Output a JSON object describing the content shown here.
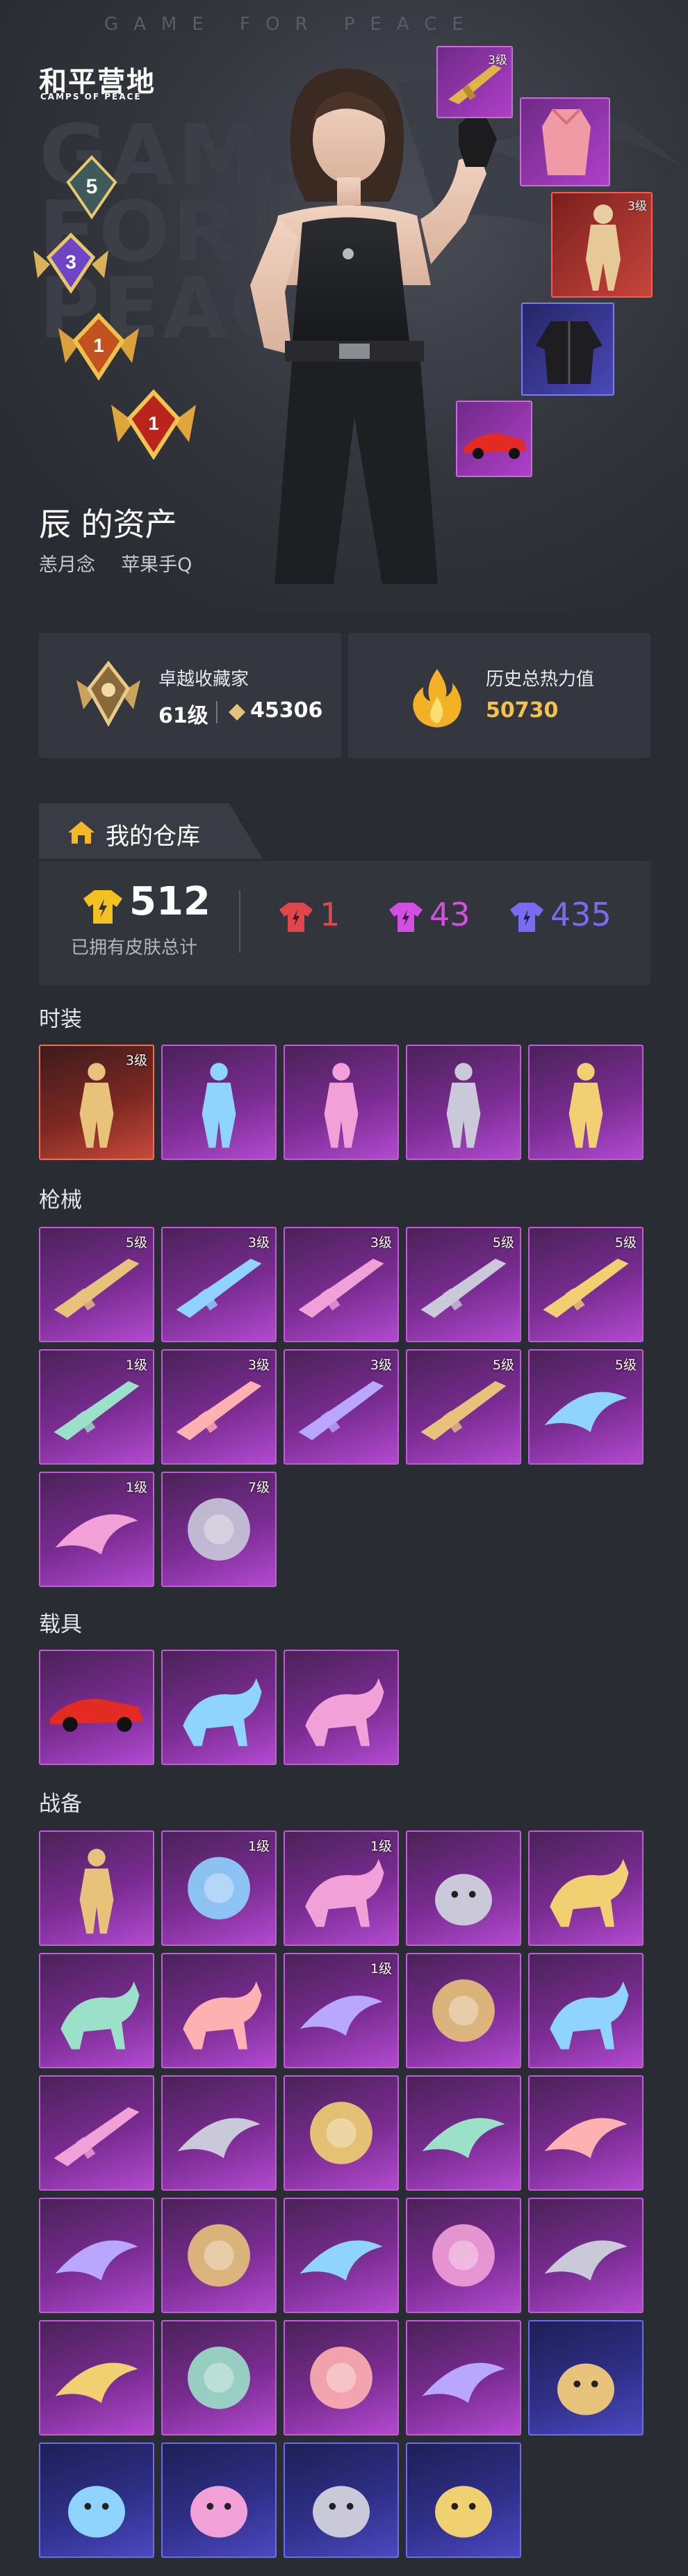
{
  "hero": {
    "brand_top": "GAME FOR PEACE",
    "logo_cn": "和平营地",
    "logo_en": "CAMPS OF PEACE",
    "bg_text": [
      "GAME",
      "FOR",
      "PEACE"
    ],
    "badges": [
      {
        "icon": "tier-5-badge-icon",
        "label": "5"
      },
      {
        "icon": "tier-3-badge-icon",
        "label": "3"
      },
      {
        "icon": "tier-1-badge-icon",
        "label": "1"
      },
      {
        "icon": "tier-1-badge-icon",
        "label": "1"
      }
    ],
    "featured_items": [
      {
        "icon": "rifle-icon",
        "level": "3级",
        "rarity": "purple"
      },
      {
        "icon": "pink-outfit-icon",
        "level": "",
        "rarity": "purple"
      },
      {
        "icon": "gold-outfit-icon",
        "level": "3级",
        "rarity": "red"
      },
      {
        "icon": "jacket-icon",
        "level": "",
        "rarity": "blue"
      },
      {
        "icon": "red-car-icon",
        "level": "",
        "rarity": "purple"
      }
    ],
    "owner_name": "辰 的资产",
    "owner_nick": "恙月念",
    "owner_account": "苹果手Q"
  },
  "stats": {
    "collector_label": "卓越收藏家",
    "collector_level": "61级",
    "collector_points": "45306",
    "heat_label": "历史总热力值",
    "heat_value": "50730"
  },
  "warehouse": {
    "tab_label": "我的仓库",
    "total_count": "512",
    "total_label": "已拥有皮肤总计",
    "rarity_counts": [
      {
        "color": "#e0474c",
        "count": "1"
      },
      {
        "color": "#d24fe0",
        "count": "43"
      },
      {
        "color": "#7a6cf0",
        "count": "435"
      }
    ]
  },
  "sections": {
    "fashion": {
      "title": "时装",
      "items": [
        {
          "icon": "gold-outfit-icon",
          "level": "3级",
          "rarity": "red"
        },
        {
          "icon": "armor-suit-icon",
          "level": "",
          "rarity": "purple"
        },
        {
          "icon": "red-armor-icon",
          "level": "",
          "rarity": "purple"
        },
        {
          "icon": "bunny-outfit-icon",
          "level": "",
          "rarity": "purple"
        },
        {
          "icon": "white-dress-icon",
          "level": "",
          "rarity": "purple"
        }
      ]
    },
    "weapons": {
      "title": "枪械",
      "items": [
        {
          "icon": "blue-rifle-icon",
          "level": "5级",
          "rarity": "purple"
        },
        {
          "icon": "gold-rifle-icon",
          "level": "3级",
          "rarity": "purple"
        },
        {
          "icon": "gold-ak-icon",
          "level": "3级",
          "rarity": "purple"
        },
        {
          "icon": "shotgun-icon",
          "level": "5级",
          "rarity": "purple"
        },
        {
          "icon": "orange-rifle-icon",
          "level": "5级",
          "rarity": "purple"
        },
        {
          "icon": "silver-rifle-icon",
          "level": "1级",
          "rarity": "purple"
        },
        {
          "icon": "pink-rifle-icon",
          "level": "3级",
          "rarity": "purple"
        },
        {
          "icon": "red-ak-icon",
          "level": "3级",
          "rarity": "purple"
        },
        {
          "icon": "sniper-rifle-icon",
          "level": "5级",
          "rarity": "purple"
        },
        {
          "icon": "gauntlet-icon",
          "level": "5级",
          "rarity": "purple"
        },
        {
          "icon": "grenade-icon",
          "level": "1级",
          "rarity": "purple"
        },
        {
          "icon": "orb-icon",
          "level": "7级",
          "rarity": "purple"
        }
      ]
    },
    "vehicles": {
      "title": "载具",
      "items": [
        {
          "icon": "red-car-icon",
          "level": "",
          "rarity": "purple"
        },
        {
          "icon": "panther-mount-icon",
          "level": "",
          "rarity": "purple"
        },
        {
          "icon": "golden-horse-icon",
          "level": "",
          "rarity": "purple"
        }
      ]
    },
    "gear": {
      "title": "战备",
      "items": [
        {
          "icon": "ghost-dress-icon",
          "level": "",
          "rarity": "purple"
        },
        {
          "icon": "gyro-parachute-icon",
          "level": "1级",
          "rarity": "purple"
        },
        {
          "icon": "egg-mount-icon",
          "level": "1级",
          "rarity": "purple"
        },
        {
          "icon": "snow-cat-icon",
          "level": "",
          "rarity": "purple"
        },
        {
          "icon": "fish-blades-icon",
          "level": "",
          "rarity": "purple"
        },
        {
          "icon": "star-creature-icon",
          "level": "",
          "rarity": "purple"
        },
        {
          "icon": "fire-bird-icon",
          "level": "",
          "rarity": "purple"
        },
        {
          "icon": "green-glider-icon",
          "level": "1级",
          "rarity": "purple"
        },
        {
          "icon": "blue-portal-icon",
          "level": "",
          "rarity": "purple"
        },
        {
          "icon": "gold-fish-icon",
          "level": "",
          "rarity": "purple"
        },
        {
          "icon": "snowflake-icon",
          "level": "",
          "rarity": "purple"
        },
        {
          "icon": "purple-wing-icon",
          "level": "",
          "rarity": "purple"
        },
        {
          "icon": "crystal-parachute-icon",
          "level": "",
          "rarity": "purple"
        },
        {
          "icon": "blue-glider-icon",
          "level": "",
          "rarity": "purple"
        },
        {
          "icon": "gold-wheel-icon",
          "level": "",
          "rarity": "purple"
        },
        {
          "icon": "dark-wing-icon",
          "level": "",
          "rarity": "purple"
        },
        {
          "icon": "sphere-parachute-icon",
          "level": "",
          "rarity": "purple"
        },
        {
          "icon": "silver-glider-icon",
          "level": "",
          "rarity": "purple"
        },
        {
          "icon": "pearl-parachute-icon",
          "level": "",
          "rarity": "purple"
        },
        {
          "icon": "gold-glider-icon",
          "level": "",
          "rarity": "purple"
        },
        {
          "icon": "jade-glider-icon",
          "level": "",
          "rarity": "purple"
        },
        {
          "icon": "star-parachute-icon",
          "level": "",
          "rarity": "purple"
        },
        {
          "icon": "shell-parachute-icon",
          "level": "",
          "rarity": "purple"
        },
        {
          "icon": "pink-glider-icon",
          "level": "",
          "rarity": "purple"
        },
        {
          "icon": "pink-bird-pet-icon",
          "level": "",
          "rarity": "blue"
        },
        {
          "icon": "yellow-chick-pet-icon",
          "level": "",
          "rarity": "blue"
        },
        {
          "icon": "white-cat-pet-icon",
          "level": "",
          "rarity": "blue"
        },
        {
          "icon": "pink-pig-pet-icon",
          "level": "",
          "rarity": "blue"
        },
        {
          "icon": "penguin-pet-icon",
          "level": "",
          "rarity": "blue"
        }
      ]
    }
  },
  "colors": {
    "background": "#2a2c33",
    "panel": "#353740",
    "purple_rarity": "#c25bd6",
    "red_rarity": "#ff6a4a",
    "blue_rarity": "#6d6bea",
    "gold": "#f6c24a"
  }
}
